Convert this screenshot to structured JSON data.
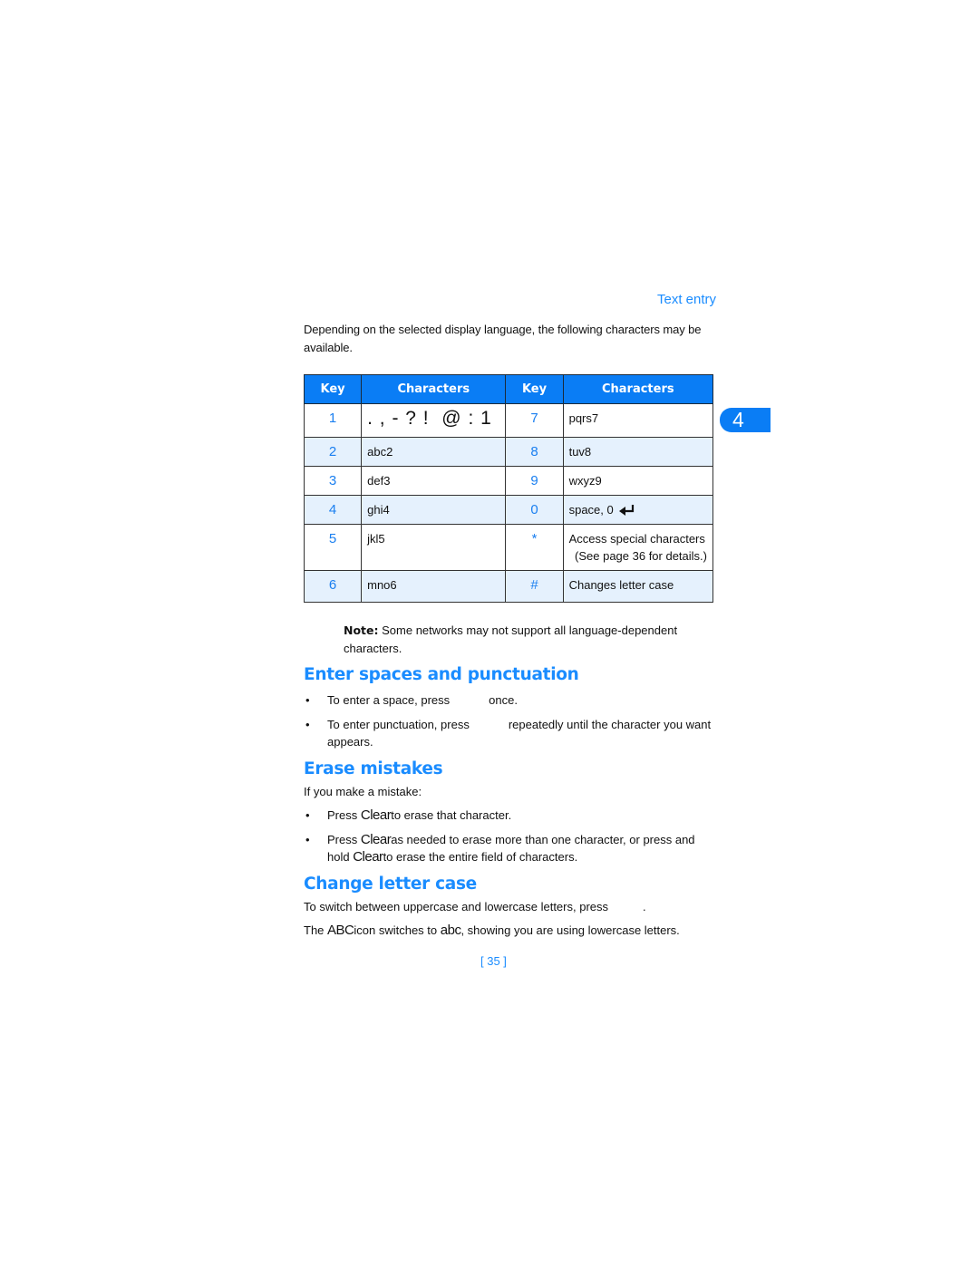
{
  "header": {
    "running_head": "Text entry",
    "chapter_tab": "4"
  },
  "intro": "Depending on the selected display language, the following characters may be available.",
  "table": {
    "headers": [
      "Key",
      "Characters",
      "Key",
      "Characters"
    ],
    "rows": [
      {
        "key_left": "1",
        "chars_left": ". , - ? !  @ : 1",
        "key_right": "7",
        "chars_right": "pqrs7"
      },
      {
        "key_left": "2",
        "chars_left": "abc2",
        "key_right": "8",
        "chars_right": "tuv8"
      },
      {
        "key_left": "3",
        "chars_left": "def3",
        "key_right": "9",
        "chars_right": "wxyz9"
      },
      {
        "key_left": "4",
        "chars_left": "ghi4",
        "key_right": "0",
        "chars_right": "space, 0",
        "right_icon": "enter-arrow-icon"
      },
      {
        "key_left": "5",
        "chars_left": "jkl5",
        "key_right": "*",
        "chars_right": "Access special characters",
        "chars_right_line2": "(See page 36 for details.)"
      },
      {
        "key_left": "6",
        "chars_left": "mno6",
        "key_right": "#",
        "chars_right": "Changes letter case"
      }
    ]
  },
  "note": {
    "label": "Note:",
    "text": " Some networks may not support all language-dependent characters."
  },
  "sections": {
    "spaces": {
      "title": "Enter spaces and punctuation",
      "bullets": [
        {
          "before": "To enter a space, press",
          "after": "once."
        },
        {
          "before": "To enter punctuation, press",
          "after": "repeatedly until the character you want appears."
        }
      ]
    },
    "erase": {
      "title": "Erase mistakes",
      "lead": "If you make a mistake:",
      "clear_word": "Clear",
      "bullet1_after": "to erase that character.",
      "bullet2_mid": "as needed to erase more than one character, or press and hold",
      "bullet2_after": "to erase the entire field of characters.",
      "press_word": "Press"
    },
    "case": {
      "title": "Change letter case",
      "line1_before": "To switch between uppercase and lowercase letters, press",
      "line1_after": ".",
      "line2_the": "The",
      "line2_upper": "ABC",
      "line2_mid": "icon switches to",
      "line2_lower": "abc",
      "line2_after": ", showing you are using lowercase letters."
    }
  },
  "footer": {
    "page_number": "[ 35 ]"
  },
  "colors": {
    "accent": "#1a8cff",
    "table_header": "#0a7df5",
    "row_alt": "#e5f1fd"
  }
}
